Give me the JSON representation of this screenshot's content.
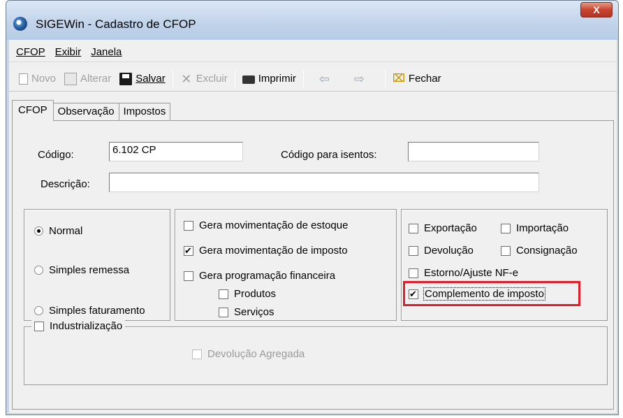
{
  "window": {
    "title": "SIGEWin - Cadastro de CFOP",
    "close_label": "X"
  },
  "menu": [
    "CFOP",
    "Exibir",
    "Janela"
  ],
  "toolbar": {
    "novo": "Novo",
    "alterar": "Alterar",
    "salvar": "Salvar",
    "excluir": "Excluir",
    "imprimir": "Imprimir",
    "fechar": "Fechar"
  },
  "tabs": [
    "CFOP",
    "Observação",
    "Impostos"
  ],
  "form": {
    "codigo_label": "Código:",
    "codigo_value": "6.102 CP",
    "codigo_isentos_label": "Código para isentos:",
    "codigo_isentos_value": "",
    "descricao_label": "Descrição:",
    "descricao_value": ""
  },
  "tipo": {
    "options": [
      "Normal",
      "Simples remessa",
      "Simples faturamento"
    ],
    "selected": "Normal"
  },
  "movimentacao": {
    "estoque": {
      "label": "Gera movimentação de estoque",
      "checked": false
    },
    "imposto": {
      "label": "Gera movimentação de imposto",
      "checked": true
    },
    "financeira": {
      "label": "Gera programação financeira",
      "checked": false
    },
    "produtos": {
      "label": "Produtos",
      "checked": false
    },
    "servicos": {
      "label": "Serviços",
      "checked": false
    }
  },
  "flags": {
    "exportacao": {
      "label": "Exportação",
      "checked": false
    },
    "importacao": {
      "label": "Importação",
      "checked": false
    },
    "devolucao": {
      "label": "Devolução",
      "checked": false
    },
    "consignacao": {
      "label": "Consignação",
      "checked": false
    },
    "estorno": {
      "label": "Estorno/Ajuste NF-e",
      "checked": false
    },
    "complemento": {
      "label": "Complemento de imposto",
      "checked": true
    }
  },
  "industrializacao": {
    "label": "Industrialização",
    "checked": false,
    "devolucao_agregada": {
      "label": "Devolução Agregada",
      "checked": false,
      "enabled": false
    }
  },
  "colors": {
    "highlight": "#e01e2e",
    "client_bg": "#f0f0f0"
  }
}
